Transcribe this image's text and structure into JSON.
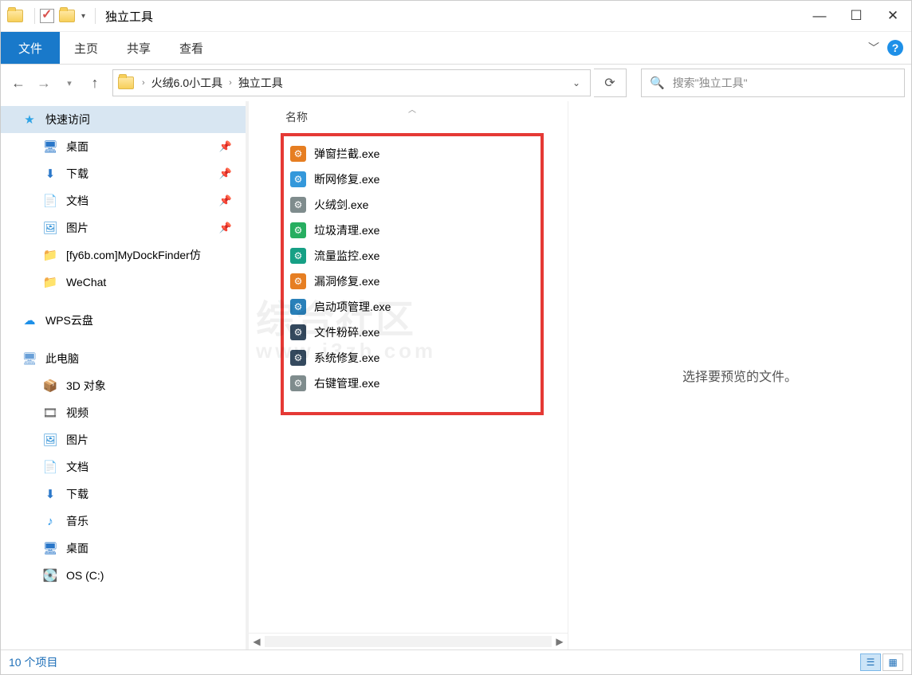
{
  "window": {
    "title": "独立工具"
  },
  "ribbon": {
    "file": "文件",
    "tabs": [
      "主页",
      "共享",
      "查看"
    ]
  },
  "breadcrumb": {
    "items": [
      "火绒6.0小工具",
      "独立工具"
    ]
  },
  "search": {
    "placeholder": "搜索\"独立工具\""
  },
  "sidebar": {
    "quick_access": {
      "label": "快速访问",
      "icon": "star"
    },
    "quick_items": [
      {
        "label": "桌面",
        "icon": "desktop",
        "pinned": true
      },
      {
        "label": "下载",
        "icon": "download",
        "pinned": true
      },
      {
        "label": "文档",
        "icon": "docs",
        "pinned": true
      },
      {
        "label": "图片",
        "icon": "pics",
        "pinned": true
      },
      {
        "label": "[fy6b.com]MyDockFinder仿",
        "icon": "folder",
        "pinned": false
      },
      {
        "label": "WeChat",
        "icon": "folder",
        "pinned": false
      }
    ],
    "wps": {
      "label": "WPS云盘",
      "icon": "cloud"
    },
    "this_pc": {
      "label": "此电脑",
      "icon": "pc"
    },
    "pc_items": [
      {
        "label": "3D 对象",
        "icon": "cube"
      },
      {
        "label": "视频",
        "icon": "video"
      },
      {
        "label": "图片",
        "icon": "pics"
      },
      {
        "label": "文档",
        "icon": "docs"
      },
      {
        "label": "下载",
        "icon": "download"
      },
      {
        "label": "音乐",
        "icon": "music"
      },
      {
        "label": "桌面",
        "icon": "desktop"
      },
      {
        "label": "OS (C:)",
        "icon": "drive"
      }
    ]
  },
  "columns": {
    "name": "名称"
  },
  "files": [
    {
      "name": "弹窗拦截.exe",
      "c": "c1"
    },
    {
      "name": "断网修复.exe",
      "c": "c2"
    },
    {
      "name": "火绒剑.exe",
      "c": "c3"
    },
    {
      "name": "垃圾清理.exe",
      "c": "c4"
    },
    {
      "name": "流量监控.exe",
      "c": "c5"
    },
    {
      "name": "漏洞修复.exe",
      "c": "c6"
    },
    {
      "name": "启动项管理.exe",
      "c": "c7"
    },
    {
      "name": "文件粉碎.exe",
      "c": "c8"
    },
    {
      "name": "系统修复.exe",
      "c": "c9"
    },
    {
      "name": "右键管理.exe",
      "c": "c10"
    }
  ],
  "preview": {
    "empty": "选择要预览的文件。"
  },
  "status": {
    "count": "10 个项目"
  },
  "watermark": {
    "main": "综合社区",
    "sub": "www.i3zh.com"
  }
}
